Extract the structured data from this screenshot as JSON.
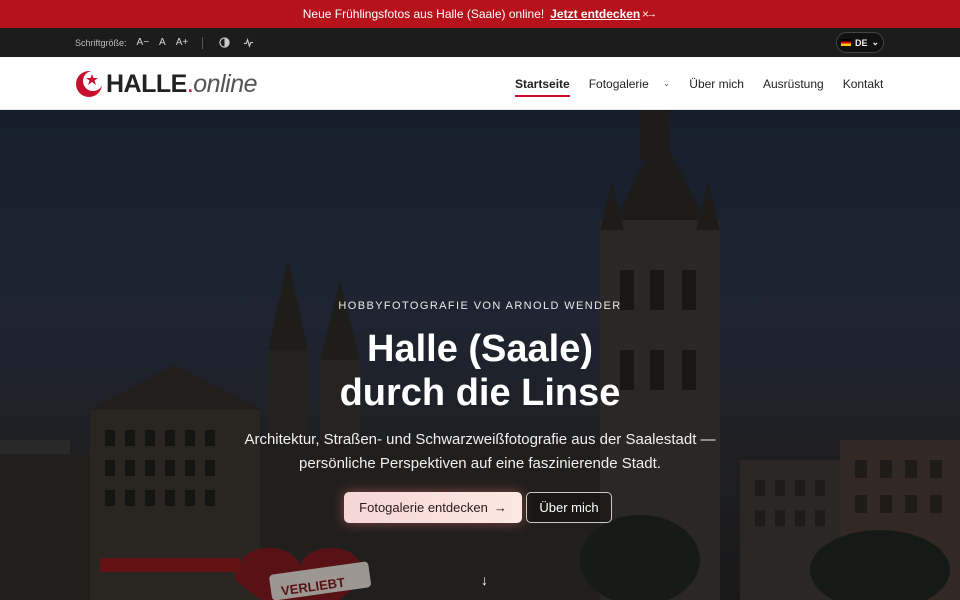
{
  "announcement": {
    "text": "Neue Frühlingsfotos aus Halle (Saale) online!",
    "link": "Jetzt entdecken",
    "arrow": "→",
    "close": "×"
  },
  "utility": {
    "font_size_label": "Schriftgröße:",
    "font_smaller": "A−",
    "font_normal": "A",
    "font_larger": "A+",
    "contrast_icon": "contrast-icon",
    "motion_icon": "pulse-icon",
    "language": "DE",
    "language_chevron": "⌄"
  },
  "header": {
    "logo_main": "HALLE",
    "logo_dot": ".",
    "logo_suffix": "online",
    "nav": [
      {
        "label": "Startseite",
        "active": true
      },
      {
        "label": "Fotogalerie",
        "has_dropdown": true
      },
      {
        "label": "Über mich"
      },
      {
        "label": "Ausrüstung"
      },
      {
        "label": "Kontakt"
      }
    ],
    "dropdown_chevron": "⌄"
  },
  "hero": {
    "eyebrow": "HOBBYFOTOGRAFIE VON ARNOLD WENDER",
    "title_line1": "Halle (Saale)",
    "title_line2": "durch die Linse",
    "subtitle_line1": "Architektur, Straßen- und Schwarzweißfotografie aus der Saalestadt —",
    "subtitle_line2": "persönliche Perspektiven auf eine faszinierende Stadt.",
    "primary_cta": "Fotogalerie entdecken",
    "primary_arrow": "→",
    "secondary_cta": "Über mich",
    "scroll_icon": "↓",
    "scene_sign_text": "VERLIEBT"
  },
  "colors": {
    "brand_red": "#b5121b",
    "accent_red": "#c8102e",
    "utility_bg": "#1c1c1c"
  }
}
